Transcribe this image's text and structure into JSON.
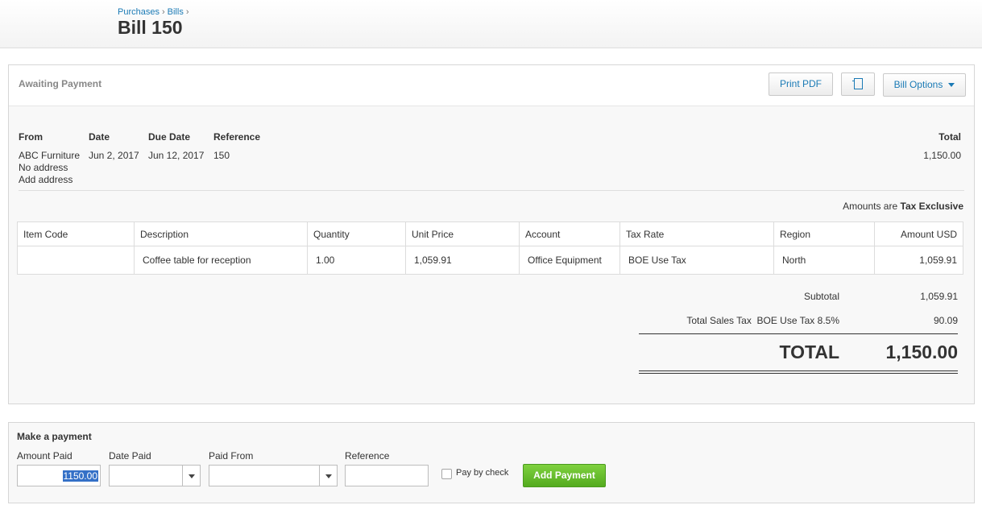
{
  "breadcrumb": {
    "purchases": "Purchases",
    "bills": "Bills",
    "separator": "›"
  },
  "page_title": "Bill 150",
  "bill": {
    "status": "Awaiting Payment",
    "toolbar": {
      "print_pdf": "Print PDF",
      "copy_icon": "copy-icon",
      "bill_options": "Bill Options"
    },
    "headers": {
      "from": "From",
      "date": "Date",
      "due_date": "Due Date",
      "reference": "Reference",
      "total": "Total"
    },
    "from_name": "ABC Furniture",
    "no_address": "No address",
    "add_address": "Add address",
    "date": "Jun 2, 2017",
    "due_date": "Jun 12, 2017",
    "reference": "150",
    "total": "1,150.00",
    "amounts_are_label": "Amounts are",
    "amounts_are_value": "Tax Exclusive",
    "columns": [
      "Item Code",
      "Description",
      "Quantity",
      "Unit Price",
      "Account",
      "Tax Rate",
      "Region",
      "Amount USD"
    ],
    "rows": [
      {
        "item_code": "",
        "description": "Coffee table for reception",
        "quantity": "1.00",
        "unit_price": "1,059.91",
        "account": "Office Equipment",
        "tax_rate": "BOE Use Tax",
        "region": "North",
        "amount": "1,059.91"
      }
    ],
    "subtotal_label": "Subtotal",
    "subtotal_value": "1,059.91",
    "sales_tax_label": "Total Sales Tax  BOE Use Tax 8.5%",
    "sales_tax_value": "90.09",
    "grand_total_label": "TOTAL",
    "grand_total_value": "1,150.00"
  },
  "payment": {
    "title": "Make a payment",
    "amount_paid_label": "Amount Paid",
    "amount_paid_value": "1150.00",
    "date_paid_label": "Date Paid",
    "paid_from_label": "Paid From",
    "reference_label": "Reference",
    "pay_by_check_label": "Pay by check",
    "pay_by_check_checked": false,
    "add_payment_label": "Add Payment"
  },
  "colors": {
    "link": "#1a7ab5",
    "add_button": "#5cb82a",
    "selection": "#3470c7"
  }
}
